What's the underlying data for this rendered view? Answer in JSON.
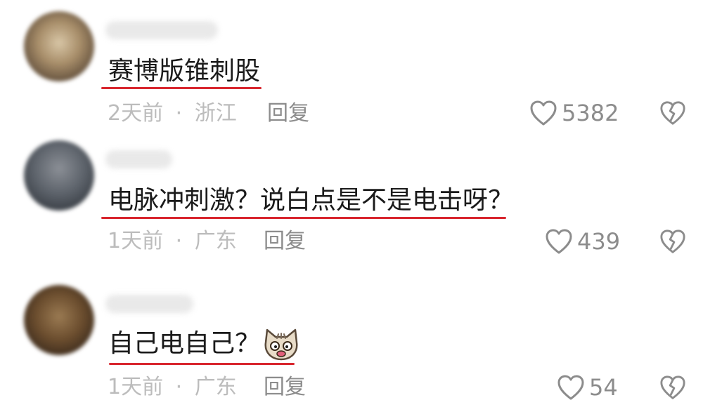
{
  "comments": [
    {
      "text": "赛博版锥刺股",
      "time": "2天前",
      "separator": "·",
      "location": "浙江",
      "reply_label": "回复",
      "likes": "5382"
    },
    {
      "text": "电脉冲刺激？说白点是不是电击呀？",
      "time": "1天前",
      "separator": "·",
      "location": "广东",
      "reply_label": "回复",
      "likes": "439"
    },
    {
      "text": "自己电自己？",
      "time": "1天前",
      "separator": "·",
      "location": "广东",
      "reply_label": "回复",
      "likes": "54"
    }
  ],
  "icons": {
    "like": "heart-outline-icon",
    "dislike": "broken-heart-icon",
    "sticker": "cat-face-emoji"
  },
  "colors": {
    "underline": "#d8262e",
    "text": "#1a1a1a",
    "meta": "#bcbcbc",
    "action": "#8c8c8c"
  }
}
